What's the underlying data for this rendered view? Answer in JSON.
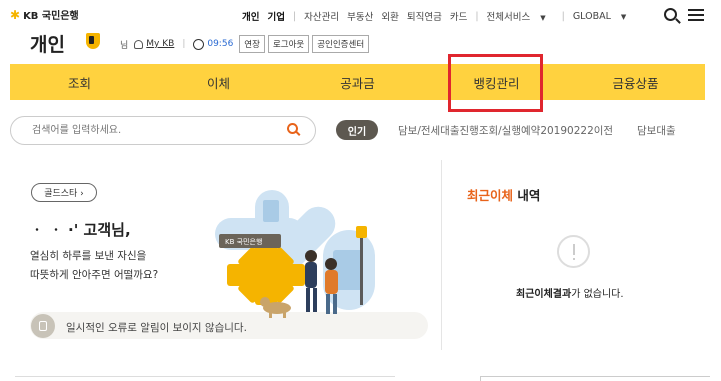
{
  "header": {
    "logo_text": "KB 국민은행",
    "top_links": {
      "personal": "개인",
      "business": "기업",
      "asset": "자산관리",
      "realestate": "부동산",
      "fx": "외환",
      "pension": "퇴직연금",
      "card": "카드",
      "all_services": "전체서비스",
      "global": "GLOBAL"
    }
  },
  "user": {
    "page_title": "개인",
    "name_suffix": "님",
    "mykb": "My KB",
    "timer": "09:56",
    "extend_label": "연장",
    "logout_label": "로그아웃",
    "cert_center_label": "공인인증센터"
  },
  "mainnav": {
    "items": [
      "조회",
      "이체",
      "공과금",
      "뱅킹관리",
      "금융상품"
    ]
  },
  "search": {
    "placeholder": "검색어를 입력하세요.",
    "popular_label": "인기",
    "popular_keyword": "담보/전세대출진행조회/실행예약20190222이전",
    "popular_keyword2": "담보대출"
  },
  "greeting": {
    "goldstar_label": "골드스타 ›",
    "name_line": "ㆍ ㆍ ·' 고객님,",
    "line1": "열심히 하루를 보낸 자신을",
    "line2": "따뜻하게 안아주면 어떨까요?",
    "notice": "일시적인 오류로 알림이 보이지 않습니다.",
    "illustration_logo": "KB 국민은행"
  },
  "recent_transfer": {
    "title_accent": "최근이체",
    "title_rest": " 내역",
    "empty_accent": "최근이체결과",
    "empty_rest": "가 없습니다."
  },
  "colors": {
    "nav_yellow": "#ffd23f",
    "accent_orange": "#e8631a",
    "highlight_red": "#e0262e",
    "badge_gray": "#5d5850"
  }
}
